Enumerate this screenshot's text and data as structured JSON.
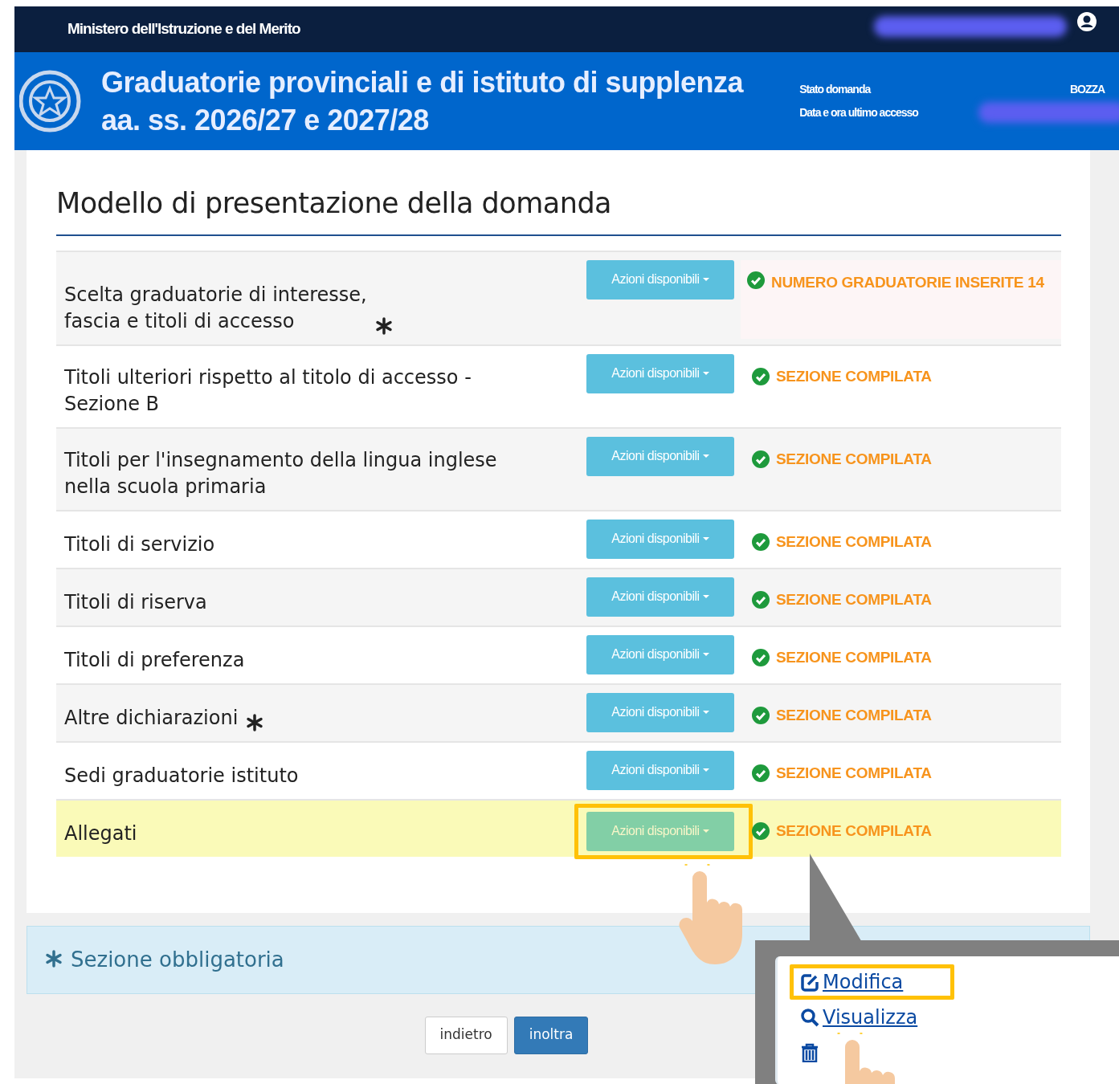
{
  "header": {
    "ministry": "Ministero dell'Istruzione e del Merito",
    "title_lines": [
      "Graduatorie provinciali e di istituto di supplenza",
      "aa. ss. 2026/27 e 2027/28"
    ],
    "status_label": "Stato domanda",
    "status_value": "BOZZA",
    "access_label": "Data e ora ultimo accesso"
  },
  "section_title": "Modello di presentazione della domanda",
  "rows": [
    {
      "lines": [
        "Scelta graduatorie di interesse,",
        "fascia e titoli di accesso"
      ],
      "required": true,
      "button": "Azioni disponibili",
      "status": "NUMERO GRADUATORIE INSERITE 14",
      "kind": "count",
      "highlighted": false
    },
    {
      "lines": [
        "Titoli ulteriori rispetto al titolo di accesso -",
        "Sezione B"
      ],
      "required": false,
      "button": "Azioni disponibili",
      "status": "SEZIONE COMPILATA",
      "kind": "done",
      "highlighted": false
    },
    {
      "lines": [
        "Titoli per l'insegnamento della lingua inglese",
        "nella scuola primaria"
      ],
      "required": false,
      "button": "Azioni disponibili",
      "status": "SEZIONE COMPILATA",
      "kind": "done",
      "highlighted": false
    },
    {
      "lines": [
        "Titoli di servizio"
      ],
      "required": false,
      "button": "Azioni disponibili",
      "status": "SEZIONE COMPILATA",
      "kind": "done",
      "highlighted": false
    },
    {
      "lines": [
        "Titoli di riserva"
      ],
      "required": false,
      "button": "Azioni disponibili",
      "status": "SEZIONE COMPILATA",
      "kind": "done",
      "highlighted": false
    },
    {
      "lines": [
        "Titoli di preferenza"
      ],
      "required": false,
      "button": "Azioni disponibili",
      "status": "SEZIONE COMPILATA",
      "kind": "done",
      "highlighted": false
    },
    {
      "lines": [
        "Altre dichiarazioni"
      ],
      "required": true,
      "button": "Azioni disponibili",
      "status": "SEZIONE COMPILATA",
      "kind": "done",
      "highlighted": false
    },
    {
      "lines": [
        "Sedi graduatorie istituto"
      ],
      "required": false,
      "button": "Azioni disponibili",
      "status": "SEZIONE COMPILATA",
      "kind": "done",
      "highlighted": false
    },
    {
      "lines": [
        "Allegati"
      ],
      "required": false,
      "button": "Azioni disponibili",
      "status": "SEZIONE COMPILATA",
      "kind": "done",
      "highlighted": true
    }
  ],
  "legend": "Sezione obbligatoria",
  "buttons": [
    {
      "label": "indietro",
      "kind": "secondary"
    },
    {
      "label": "inoltra",
      "kind": "primary"
    }
  ],
  "callout": {
    "items": [
      {
        "label": "Modifica",
        "kind": "edit",
        "highlighted": true
      },
      {
        "label": "Visualizza",
        "kind": "view",
        "highlighted": false
      },
      {
        "kind": "delete",
        "highlighted": false
      }
    ]
  }
}
